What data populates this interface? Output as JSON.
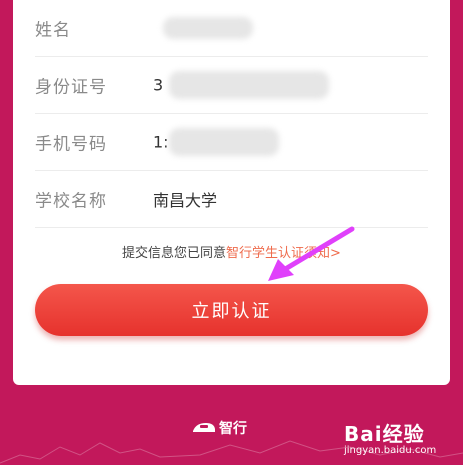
{
  "form": {
    "fields": [
      {
        "label": "姓名",
        "value": ""
      },
      {
        "label": "身份证号",
        "value": "3"
      },
      {
        "label": "手机号码",
        "value": "1:"
      },
      {
        "label": "学校名称",
        "value": "南昌大学"
      }
    ]
  },
  "agreement": {
    "prefix": "提交信息您已同意",
    "link": "智行学生认证须知>"
  },
  "submit_button": {
    "label": "立即认证"
  },
  "footer": {
    "logo_text": "智行"
  },
  "watermark": {
    "brand": "Bai经验",
    "domain": "jingyan.baidu.com"
  },
  "colors": {
    "background": "#c2185b",
    "button": "#e6322d",
    "link": "#ef6b4c",
    "pointer": "#e040fb"
  }
}
